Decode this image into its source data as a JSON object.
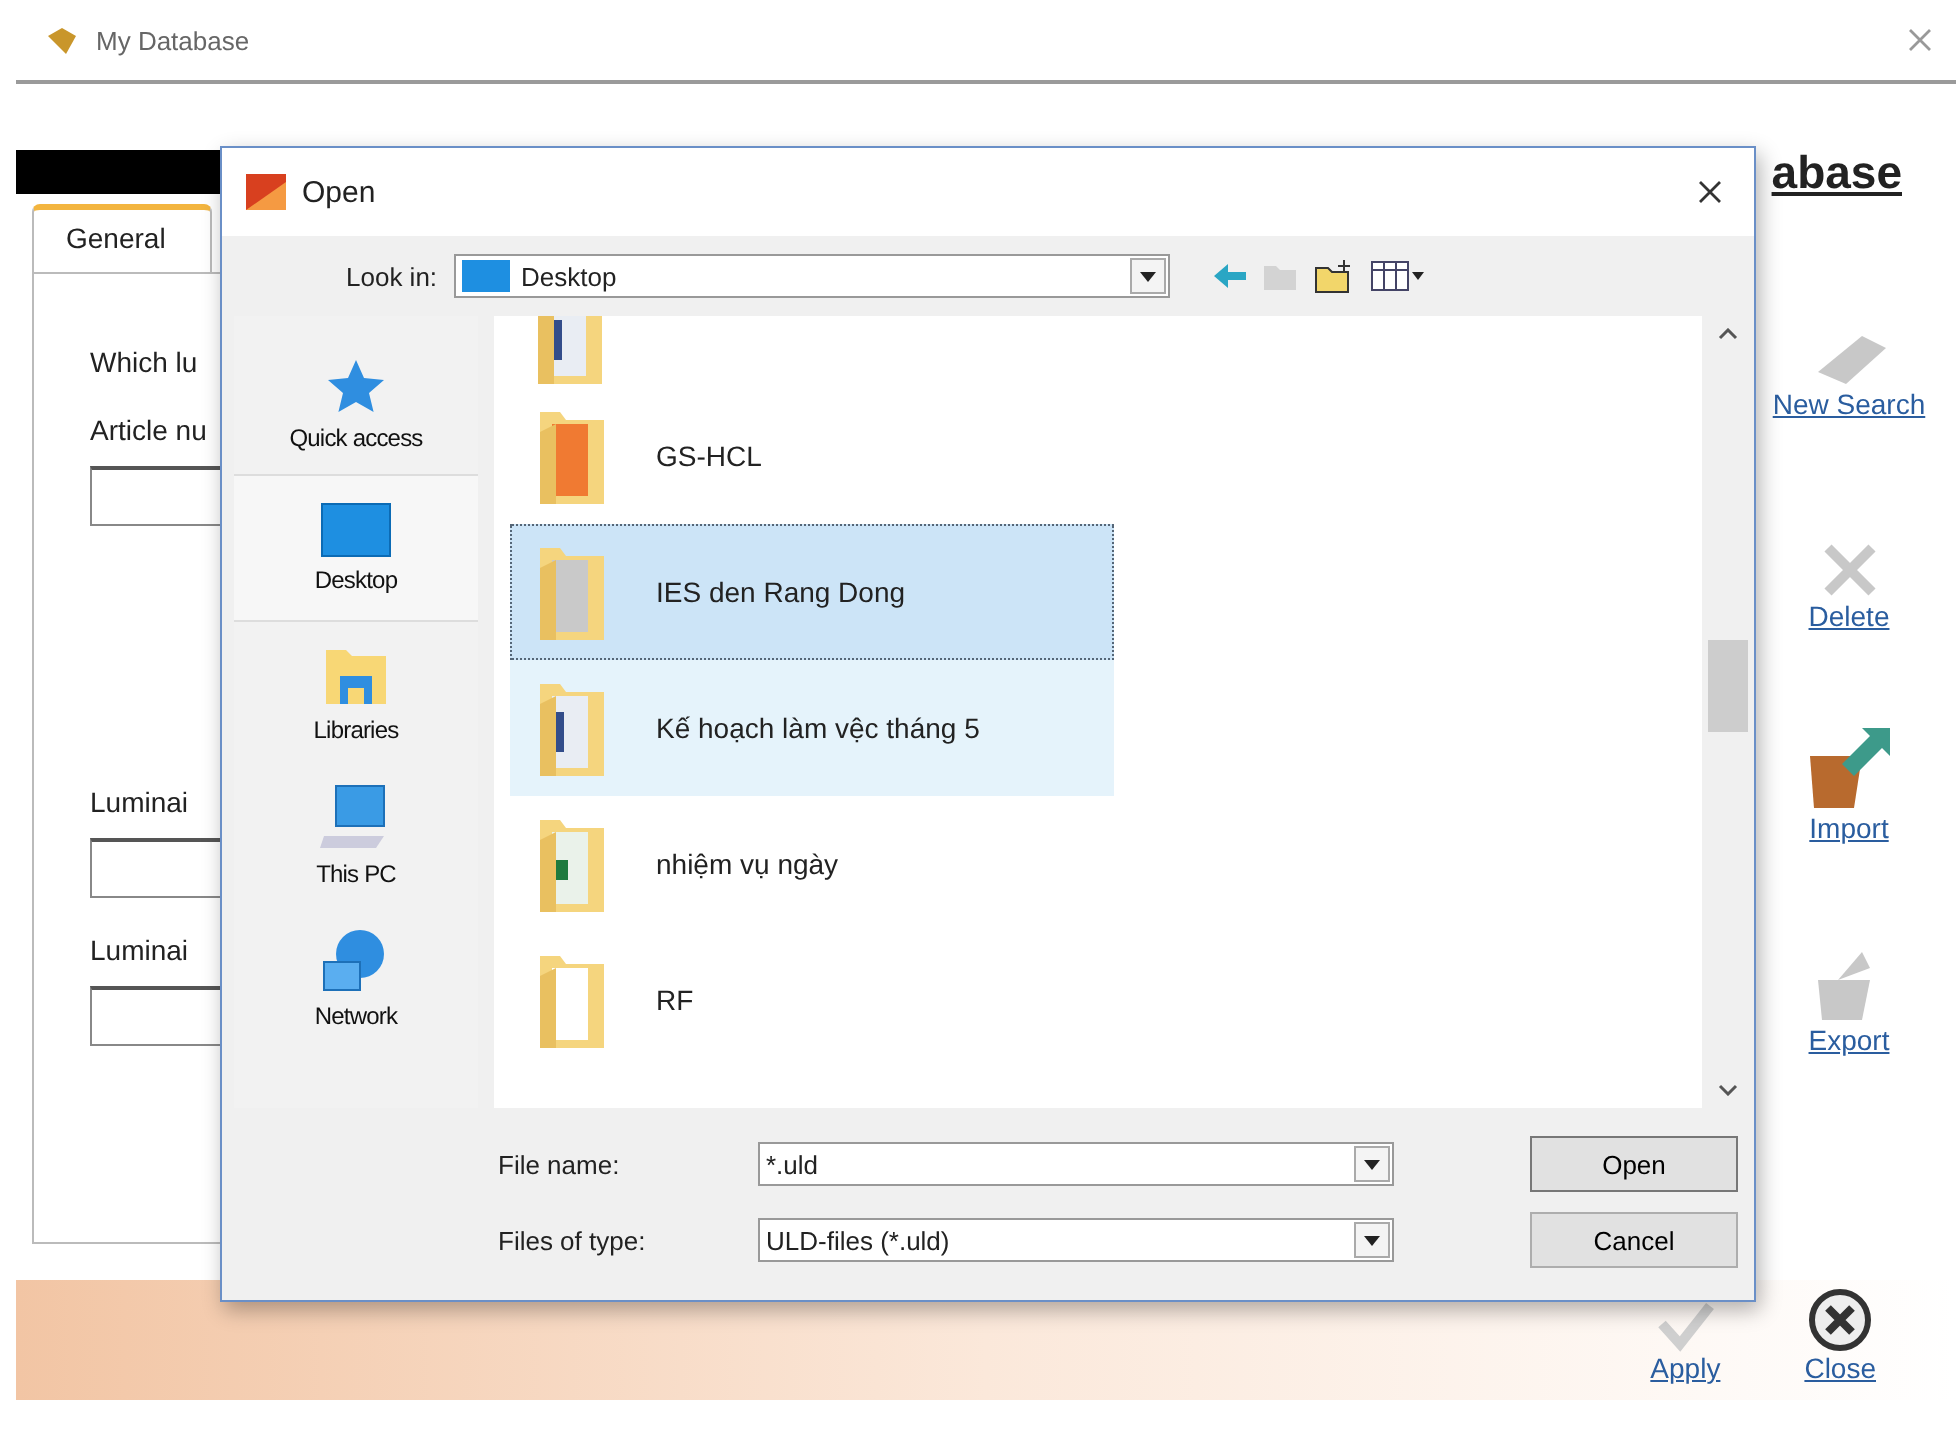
{
  "window": {
    "title": "My Database"
  },
  "header": {
    "title": "abase"
  },
  "tabs": [
    {
      "label": "General",
      "selected": true
    }
  ],
  "form": [
    {
      "label": "Which lu",
      "input": false
    },
    {
      "label": "Article nu",
      "input": true
    },
    {
      "label": "Luminai",
      "input": true
    },
    {
      "label": "Luminai",
      "input": true
    }
  ],
  "sidebar": [
    {
      "label": "New Search",
      "kind": "new-search",
      "disabled": true
    },
    {
      "label": "Delete",
      "kind": "delete",
      "disabled": true
    },
    {
      "label": "Import",
      "kind": "import",
      "disabled": false
    },
    {
      "label": "Export",
      "kind": "export",
      "disabled": true
    }
  ],
  "footer": [
    {
      "label": "Apply",
      "kind": "apply",
      "disabled": true
    },
    {
      "label": "Close",
      "kind": "close",
      "disabled": false
    }
  ],
  "dialog": {
    "title": "Open",
    "look_in": {
      "label": "Look in:",
      "value": "Desktop"
    },
    "places": [
      {
        "label": "Quick access",
        "kind": "star",
        "selected": false
      },
      {
        "label": "Desktop",
        "kind": "desktop",
        "selected": true
      },
      {
        "label": "Libraries",
        "kind": "libraries",
        "selected": false
      },
      {
        "label": "This PC",
        "kind": "pc",
        "selected": false
      },
      {
        "label": "Network",
        "kind": "network",
        "selected": false
      }
    ],
    "files": [
      {
        "name": "GS-HCL",
        "kind": "orange",
        "selected": false,
        "hovered": false
      },
      {
        "name": "IES den Rang Dong",
        "kind": "grey",
        "selected": true,
        "hovered": false
      },
      {
        "name": "Kế hoạch làm vệc tháng 5",
        "kind": "doc",
        "selected": false,
        "hovered": true
      },
      {
        "name": "nhiệm vụ ngày",
        "kind": "sheet",
        "selected": false,
        "hovered": false
      },
      {
        "name": "RF",
        "kind": "plain",
        "selected": false,
        "hovered": false
      }
    ],
    "file_name": {
      "label": "File name:",
      "value": "*.uld"
    },
    "file_type": {
      "label": "Files of type:",
      "value": "ULD-files (*.uld)"
    },
    "buttons": [
      "Open",
      "Cancel"
    ]
  }
}
